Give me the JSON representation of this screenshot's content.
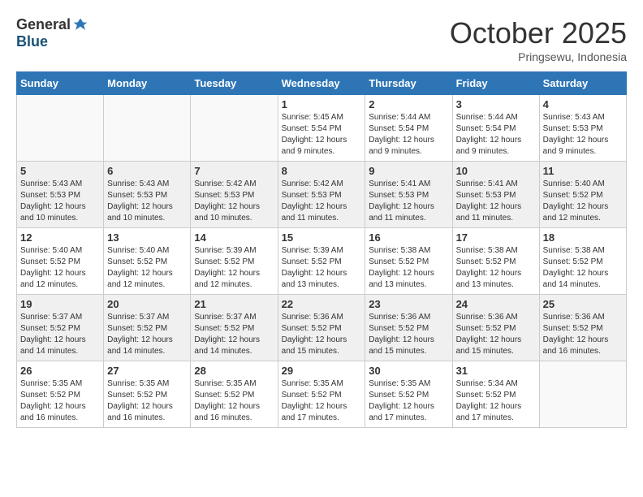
{
  "header": {
    "logo_general": "General",
    "logo_blue": "Blue",
    "month": "October 2025",
    "location": "Pringsewu, Indonesia"
  },
  "weekdays": [
    "Sunday",
    "Monday",
    "Tuesday",
    "Wednesday",
    "Thursday",
    "Friday",
    "Saturday"
  ],
  "weeks": [
    [
      {
        "day": "",
        "info": ""
      },
      {
        "day": "",
        "info": ""
      },
      {
        "day": "",
        "info": ""
      },
      {
        "day": "1",
        "info": "Sunrise: 5:45 AM\nSunset: 5:54 PM\nDaylight: 12 hours\nand 9 minutes."
      },
      {
        "day": "2",
        "info": "Sunrise: 5:44 AM\nSunset: 5:54 PM\nDaylight: 12 hours\nand 9 minutes."
      },
      {
        "day": "3",
        "info": "Sunrise: 5:44 AM\nSunset: 5:54 PM\nDaylight: 12 hours\nand 9 minutes."
      },
      {
        "day": "4",
        "info": "Sunrise: 5:43 AM\nSunset: 5:53 PM\nDaylight: 12 hours\nand 9 minutes."
      }
    ],
    [
      {
        "day": "5",
        "info": "Sunrise: 5:43 AM\nSunset: 5:53 PM\nDaylight: 12 hours\nand 10 minutes."
      },
      {
        "day": "6",
        "info": "Sunrise: 5:43 AM\nSunset: 5:53 PM\nDaylight: 12 hours\nand 10 minutes."
      },
      {
        "day": "7",
        "info": "Sunrise: 5:42 AM\nSunset: 5:53 PM\nDaylight: 12 hours\nand 10 minutes."
      },
      {
        "day": "8",
        "info": "Sunrise: 5:42 AM\nSunset: 5:53 PM\nDaylight: 12 hours\nand 11 minutes."
      },
      {
        "day": "9",
        "info": "Sunrise: 5:41 AM\nSunset: 5:53 PM\nDaylight: 12 hours\nand 11 minutes."
      },
      {
        "day": "10",
        "info": "Sunrise: 5:41 AM\nSunset: 5:53 PM\nDaylight: 12 hours\nand 11 minutes."
      },
      {
        "day": "11",
        "info": "Sunrise: 5:40 AM\nSunset: 5:52 PM\nDaylight: 12 hours\nand 12 minutes."
      }
    ],
    [
      {
        "day": "12",
        "info": "Sunrise: 5:40 AM\nSunset: 5:52 PM\nDaylight: 12 hours\nand 12 minutes."
      },
      {
        "day": "13",
        "info": "Sunrise: 5:40 AM\nSunset: 5:52 PM\nDaylight: 12 hours\nand 12 minutes."
      },
      {
        "day": "14",
        "info": "Sunrise: 5:39 AM\nSunset: 5:52 PM\nDaylight: 12 hours\nand 12 minutes."
      },
      {
        "day": "15",
        "info": "Sunrise: 5:39 AM\nSunset: 5:52 PM\nDaylight: 12 hours\nand 13 minutes."
      },
      {
        "day": "16",
        "info": "Sunrise: 5:38 AM\nSunset: 5:52 PM\nDaylight: 12 hours\nand 13 minutes."
      },
      {
        "day": "17",
        "info": "Sunrise: 5:38 AM\nSunset: 5:52 PM\nDaylight: 12 hours\nand 13 minutes."
      },
      {
        "day": "18",
        "info": "Sunrise: 5:38 AM\nSunset: 5:52 PM\nDaylight: 12 hours\nand 14 minutes."
      }
    ],
    [
      {
        "day": "19",
        "info": "Sunrise: 5:37 AM\nSunset: 5:52 PM\nDaylight: 12 hours\nand 14 minutes."
      },
      {
        "day": "20",
        "info": "Sunrise: 5:37 AM\nSunset: 5:52 PM\nDaylight: 12 hours\nand 14 minutes."
      },
      {
        "day": "21",
        "info": "Sunrise: 5:37 AM\nSunset: 5:52 PM\nDaylight: 12 hours\nand 14 minutes."
      },
      {
        "day": "22",
        "info": "Sunrise: 5:36 AM\nSunset: 5:52 PM\nDaylight: 12 hours\nand 15 minutes."
      },
      {
        "day": "23",
        "info": "Sunrise: 5:36 AM\nSunset: 5:52 PM\nDaylight: 12 hours\nand 15 minutes."
      },
      {
        "day": "24",
        "info": "Sunrise: 5:36 AM\nSunset: 5:52 PM\nDaylight: 12 hours\nand 15 minutes."
      },
      {
        "day": "25",
        "info": "Sunrise: 5:36 AM\nSunset: 5:52 PM\nDaylight: 12 hours\nand 16 minutes."
      }
    ],
    [
      {
        "day": "26",
        "info": "Sunrise: 5:35 AM\nSunset: 5:52 PM\nDaylight: 12 hours\nand 16 minutes."
      },
      {
        "day": "27",
        "info": "Sunrise: 5:35 AM\nSunset: 5:52 PM\nDaylight: 12 hours\nand 16 minutes."
      },
      {
        "day": "28",
        "info": "Sunrise: 5:35 AM\nSunset: 5:52 PM\nDaylight: 12 hours\nand 16 minutes."
      },
      {
        "day": "29",
        "info": "Sunrise: 5:35 AM\nSunset: 5:52 PM\nDaylight: 12 hours\nand 17 minutes."
      },
      {
        "day": "30",
        "info": "Sunrise: 5:35 AM\nSunset: 5:52 PM\nDaylight: 12 hours\nand 17 minutes."
      },
      {
        "day": "31",
        "info": "Sunrise: 5:34 AM\nSunset: 5:52 PM\nDaylight: 12 hours\nand 17 minutes."
      },
      {
        "day": "",
        "info": ""
      }
    ]
  ]
}
